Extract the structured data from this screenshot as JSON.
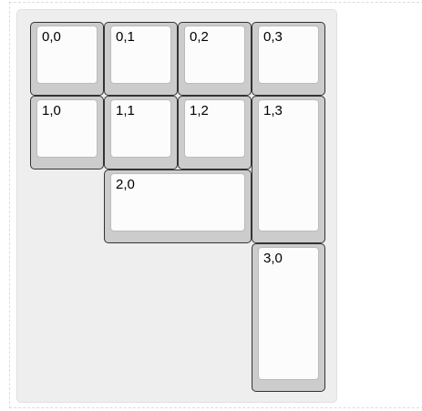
{
  "keyboard": {
    "keys": [
      {
        "id": "0,0",
        "label": "0,0"
      },
      {
        "id": "0,1",
        "label": "0,1"
      },
      {
        "id": "0,2",
        "label": "0,2"
      },
      {
        "id": "0,3",
        "label": "0,3"
      },
      {
        "id": "1,0",
        "label": "1,0"
      },
      {
        "id": "1,1",
        "label": "1,1"
      },
      {
        "id": "1,2",
        "label": "1,2"
      },
      {
        "id": "1,3",
        "label": "1,3"
      },
      {
        "id": "2,0",
        "label": "2,0"
      },
      {
        "id": "3,0",
        "label": "3,0"
      }
    ]
  },
  "colors": {
    "panel_background": "#eeeeee",
    "key_body": "#cccccc",
    "key_border": "#333333",
    "keycap_face": "#fcfcfc"
  }
}
